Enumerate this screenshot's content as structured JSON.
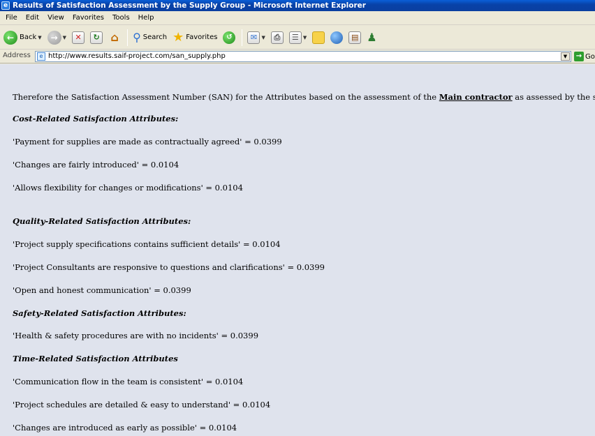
{
  "window": {
    "title": "Results of Satisfaction Assessment by the Supply Group - Microsoft Internet Explorer"
  },
  "menu": [
    "File",
    "Edit",
    "View",
    "Favorites",
    "Tools",
    "Help"
  ],
  "toolbar": {
    "back_label": "Back",
    "search_label": "Search",
    "favorites_label": "Favorites"
  },
  "address": {
    "label": "Address",
    "url": "http://www.results.saif-project.com/san_supply.php",
    "go_label": "Go"
  },
  "content": {
    "intro_prefix": "Therefore the Satisfaction Assessment Number (SAN) for the Attributes based on the assessment of the ",
    "intro_emphasis": "Main contractor",
    "intro_suffix": " as assessed by the supplier includes:",
    "sections": [
      {
        "heading": "Cost-Related Satisfaction Attributes:",
        "items": [
          "'Payment for supplies are made as contractually agreed' = 0.0399",
          "'Changes are fairly introduced' = 0.0104",
          "'Allows flexibility for changes or modifications' = 0.0104"
        ]
      },
      {
        "heading": "Quality-Related Satisfaction Attributes:",
        "items": [
          "'Project supply specifications contains sufficient details' = 0.0104",
          "'Project Consultants are responsive to questions and clarifications' = 0.0399",
          "'Open and honest communication' = 0.0399"
        ]
      },
      {
        "heading": "Safety-Related Satisfaction Attributes:",
        "items": [
          "'Health & safety procedures are with no incidents' = 0.0399"
        ]
      },
      {
        "heading": "Time-Related Satisfaction Attributes",
        "items": [
          "'Communication flow in the team is consistent' = 0.0104",
          "'Project schedules are detailed & easy to understand' = 0.0104",
          "'Changes are introduced as early as possible' = 0.0104"
        ]
      }
    ]
  }
}
